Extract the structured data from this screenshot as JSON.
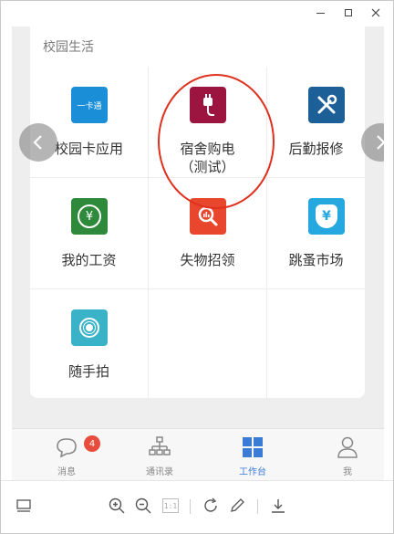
{
  "window": {
    "controls": [
      "minimize",
      "maximize",
      "close"
    ]
  },
  "section": {
    "title": "校园生活"
  },
  "apps": [
    {
      "label": "校园卡应用",
      "color": "#1a8fd8",
      "icon": "campus-card-icon",
      "icon_text": "一卡通"
    },
    {
      "label": "宿舍购电\n（测试）",
      "color": "#9b1540",
      "icon": "power-plug-icon"
    },
    {
      "label": "后勤报修",
      "color": "#1d5f97",
      "icon": "tools-icon"
    },
    {
      "label": "我的工资",
      "color": "#2e8a3a",
      "icon": "salary-icon",
      "icon_text": "¥"
    },
    {
      "label": "失物招领",
      "color": "#e8472d",
      "icon": "search-chart-icon"
    },
    {
      "label": "跳蚤市场",
      "color": "#25a7e0",
      "icon": "market-bag-icon",
      "icon_text": "¥"
    },
    {
      "label": "随手拍",
      "color": "#3ab3c8",
      "icon": "camera-icon"
    }
  ],
  "tabs": [
    {
      "label": "消息",
      "icon": "chat-bubble-icon",
      "badge": "4",
      "active": false
    },
    {
      "label": "通讯录",
      "icon": "org-chart-icon",
      "active": false
    },
    {
      "label": "工作台",
      "icon": "grid-icon",
      "active": true
    },
    {
      "label": "我",
      "icon": "person-icon",
      "active": false
    }
  ],
  "toolbar": {
    "page_indicator": "1:1",
    "tools": [
      "panel-icon",
      "zoom-in-icon",
      "zoom-out-icon",
      "actual-size-icon",
      "rotate-icon",
      "edit-pen-icon",
      "download-icon"
    ]
  },
  "colors": {
    "accent": "#3a7bd5",
    "highlight": "#e0301e",
    "badge": "#e84c3d"
  }
}
